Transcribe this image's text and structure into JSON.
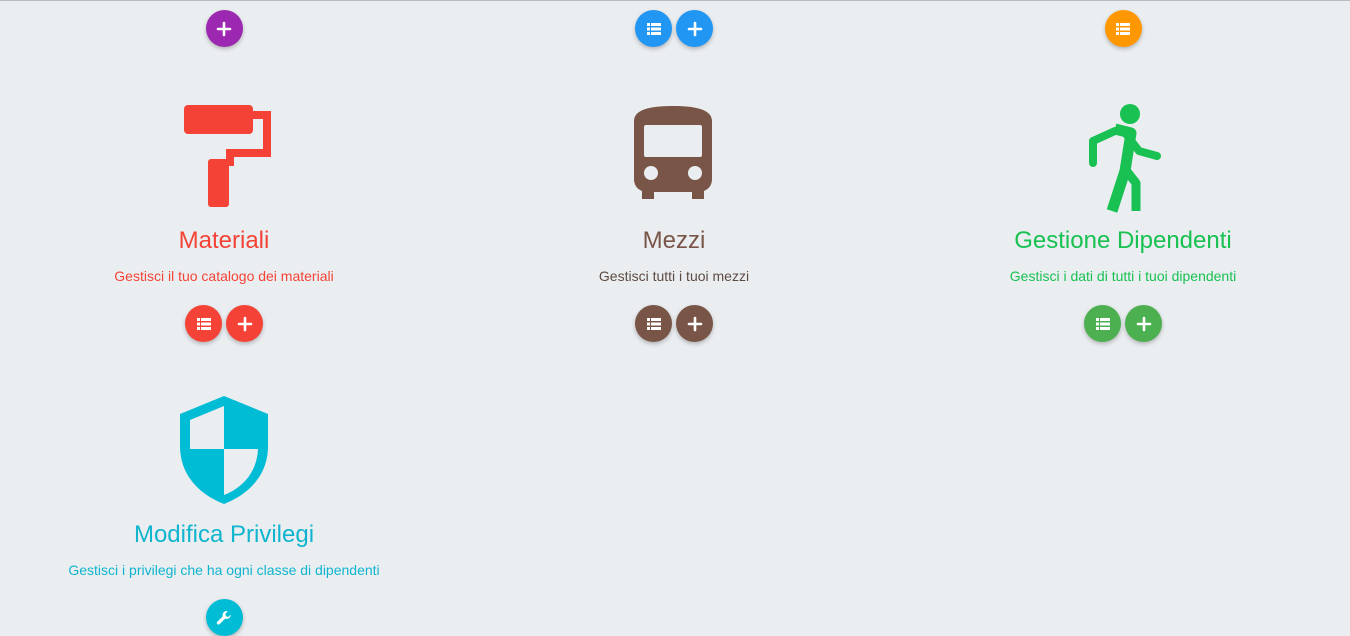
{
  "colors": {
    "background": "#ebeef1",
    "purple": "#9c27b0",
    "blue": "#2196f3",
    "orange": "#ff9800",
    "red": "#f44336",
    "brown": "#795548",
    "green": "#4caf50",
    "green_text": "#18c152",
    "cyan": "#00bcd4"
  },
  "top_row": [
    {
      "buttons": [
        "plus-icon"
      ]
    },
    {
      "buttons": [
        "list-icon",
        "plus-icon"
      ]
    },
    {
      "buttons": [
        "list-icon"
      ]
    }
  ],
  "cards": [
    {
      "icon": "paint-roller-icon",
      "title": "Materiali",
      "description": "Gestisci il tuo catalogo dei materiali",
      "buttons": [
        "list-icon",
        "plus-icon"
      ]
    },
    {
      "icon": "bus-icon",
      "title": "Mezzi",
      "description": "Gestisci tutti i tuoi mezzi",
      "buttons": [
        "list-icon",
        "plus-icon"
      ]
    },
    {
      "icon": "walking-person-icon",
      "title": "Gestione Dipendenti",
      "description": "Gestisci i dati di tutti i tuoi dipendenti",
      "buttons": [
        "list-icon",
        "plus-icon"
      ]
    },
    {
      "icon": "shield-icon",
      "title": "Modifica Privilegi",
      "description": "Gestisci i privilegi che ha ogni classe di dipendenti",
      "buttons": [
        "wrench-icon"
      ]
    }
  ]
}
